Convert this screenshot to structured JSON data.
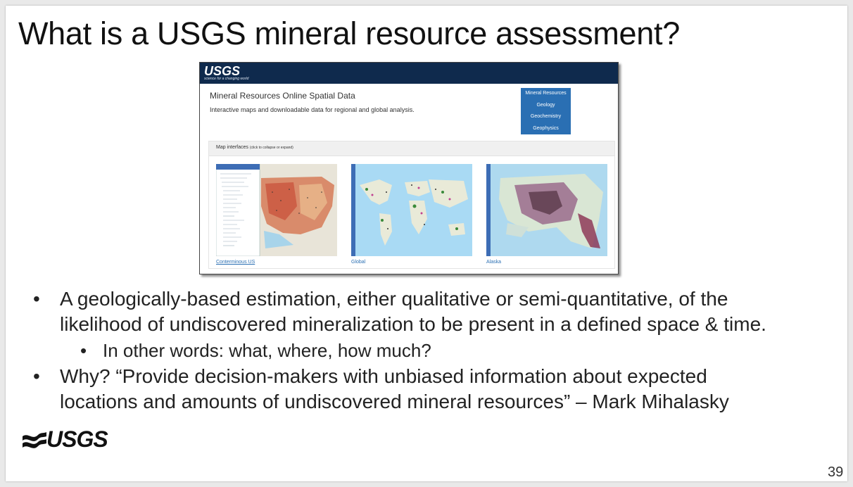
{
  "slide": {
    "title": "What is a USGS mineral resource assessment?",
    "page_number": "39",
    "footer_logo": "USGS"
  },
  "screenshot": {
    "header_logo": "USGS",
    "header_tagline": "science for a changing world",
    "site_title": "Mineral Resources Online Spatial Data",
    "site_subtitle": "Interactive maps and downloadable data for regional and global analysis.",
    "nav_items": [
      "Mineral Resources",
      "Geology",
      "Geochemistry",
      "Geophysics"
    ],
    "map_panel_title": "Map interfaces",
    "map_panel_hint": "(click to collapse or expand)",
    "maps": [
      {
        "label": "Conterminous US"
      },
      {
        "label": "Global"
      },
      {
        "label": "Alaska"
      }
    ],
    "colors": {
      "header": "#0f2a4d",
      "nav": "#2a6fb3",
      "link": "#2a6fb3"
    }
  },
  "bullets": [
    {
      "line1": "A geologically-based estimation, either qualitative or semi-quantitative, of the",
      "line2": "likelihood of undiscovered mineralization to be present in a defined space & time.",
      "sub": "In other words: what, where, how much?"
    },
    {
      "line1": "Why? “Provide decision-makers with unbiased information about expected",
      "line2": "locations and amounts of undiscovered mineral resources” – Mark Mihalasky"
    }
  ],
  "bullet_glyph": "•"
}
